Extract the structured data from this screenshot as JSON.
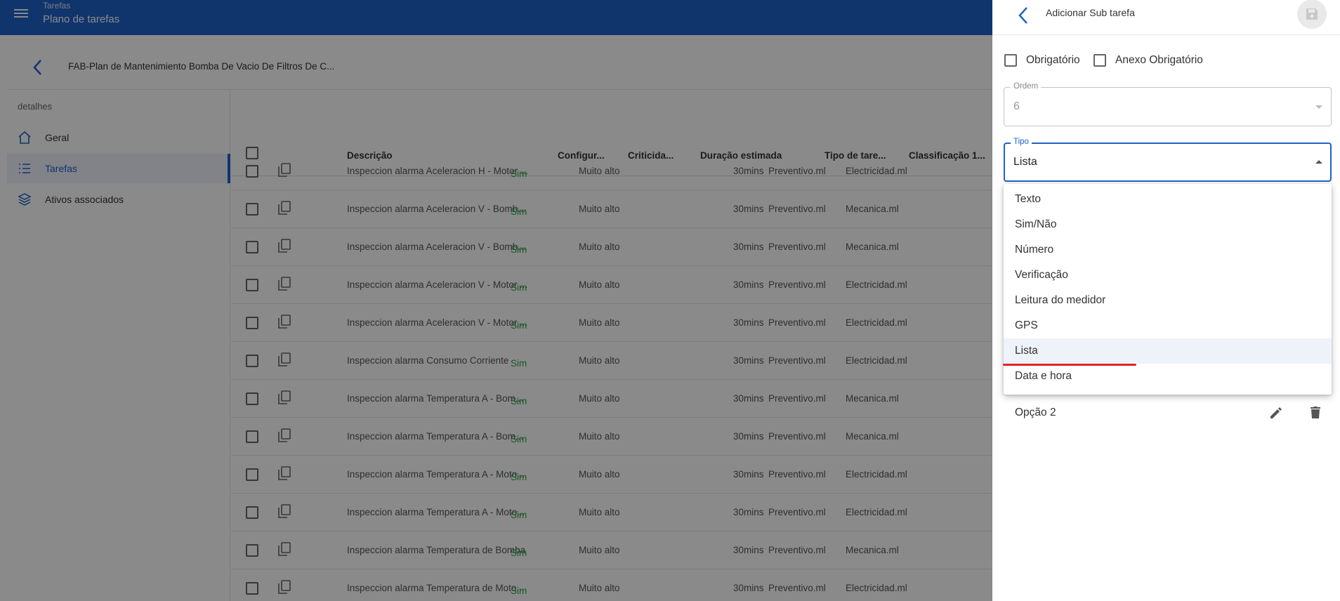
{
  "topbar": {
    "section": "Tarefas",
    "page": "Plano de tarefas"
  },
  "plan": {
    "title": "FAB-Plan de Mantenimiento Bomba De Vacio De Filtros De C..."
  },
  "sidebar": {
    "section_label": "detalhes",
    "items": [
      {
        "label": "Geral",
        "icon": "home-icon",
        "active": false
      },
      {
        "label": "Tarefas",
        "icon": "list-icon",
        "active": true
      },
      {
        "label": "Ativos associados",
        "icon": "layers-icon",
        "active": false
      }
    ]
  },
  "table": {
    "columns": [
      "Descrição",
      "Configur...",
      "Criticida...",
      "Duração estimada",
      "Tipo de tare...",
      "Classificação 1..."
    ],
    "rows": [
      [
        "Inspeccion alarma Aceleracion H - Motor ...",
        "Sim",
        "Muito alto",
        "30mins",
        "Preventivo.ml",
        "Electricidad.ml"
      ],
      [
        "Inspeccion alarma Aceleracion V - Bomb...",
        "Sim",
        "Muito alto",
        "30mins",
        "Preventivo.ml",
        "Mecanica.ml"
      ],
      [
        "Inspeccion alarma Aceleracion V - Bomb...",
        "Sim",
        "Muito alto",
        "30mins",
        "Preventivo.ml",
        "Mecanica.ml"
      ],
      [
        "Inspeccion alarma Aceleracion V - Motor ...",
        "Sim",
        "Muito alto",
        "30mins",
        "Preventivo.ml",
        "Electricidad.ml"
      ],
      [
        "Inspeccion alarma Aceleracion V - Motor ...",
        "Sim",
        "Muito alto",
        "30mins",
        "Preventivo.ml",
        "Electricidad.ml"
      ],
      [
        "Inspeccion alarma Consumo Corriente",
        "Sim",
        "Muito alto",
        "30mins",
        "Preventivo.ml",
        "Electricidad.ml"
      ],
      [
        "Inspeccion alarma Temperatura A - Bom...",
        "Sim",
        "Muito alto",
        "30mins",
        "Preventivo.ml",
        "Mecanica.ml"
      ],
      [
        "Inspeccion alarma Temperatura A - Bom...",
        "Sim",
        "Muito alto",
        "30mins",
        "Preventivo.ml",
        "Mecanica.ml"
      ],
      [
        "Inspeccion alarma Temperatura A - Moto...",
        "Sim",
        "Muito alto",
        "30mins",
        "Preventivo.ml",
        "Electricidad.ml"
      ],
      [
        "Inspeccion alarma Temperatura A - Moto...",
        "Sim",
        "Muito alto",
        "30mins",
        "Preventivo.ml",
        "Electricidad.ml"
      ],
      [
        "Inspeccion alarma Temperatura de Bomba",
        "Sim",
        "Muito alto",
        "30mins",
        "Preventivo.ml",
        "Mecanica.ml"
      ],
      [
        "Inspeccion alarma Temperatura de Moto...",
        "Sim",
        "Muito alto",
        "30mins",
        "Preventivo.ml",
        "Electricidad.ml"
      ]
    ]
  },
  "drawer": {
    "title": "Adicionar Sub tarefa",
    "mandatory_label": "Obrigatório",
    "attachment_label": "Anexo Obrigatório",
    "order": {
      "label": "Ordem",
      "value": "6"
    },
    "type": {
      "label": "Tipo",
      "value": "Lista"
    },
    "type_options": [
      "Texto",
      "Sim/Não",
      "Número",
      "Verificação",
      "Leitura do medidor",
      "GPS",
      "Lista",
      "Data e hora"
    ],
    "selected_option": "Lista",
    "list_option": "Opção 2"
  },
  "colors": {
    "primary": "#1e62c9",
    "success": "#28a745",
    "highlight": "#e02424"
  }
}
